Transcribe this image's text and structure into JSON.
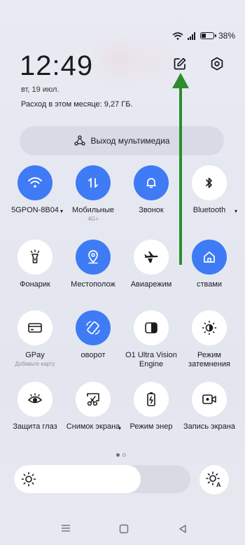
{
  "status": {
    "battery": "38%",
    "battery_level": 0.38,
    "signal_icon": "wifi-signal-icon"
  },
  "header": {
    "time": "12:49",
    "date": "вт, 19 июл.",
    "usage": "Расход в этом месяце: 9,27 ГБ."
  },
  "media": {
    "label": "Выход мультимедиа"
  },
  "tiles": [
    {
      "label": "5GPON-8B04",
      "sub": "",
      "icon": "wifi-icon",
      "state": "on"
    },
    {
      "label": "Мобильные",
      "sub": "4G+",
      "icon": "mobile-data-icon",
      "state": "on"
    },
    {
      "label": "Звонок",
      "sub": "",
      "icon": "bell-icon",
      "state": "on"
    },
    {
      "label": "Bluetooth",
      "sub": "",
      "icon": "bluetooth-icon",
      "state": "off"
    },
    {
      "label": "Фонарик",
      "sub": "",
      "icon": "flashlight-icon",
      "state": "off"
    },
    {
      "label": "Местополож",
      "sub": "",
      "icon": "location-icon",
      "state": "on"
    },
    {
      "label": "Авиарежим",
      "sub": "",
      "icon": "airplane-icon",
      "state": "off"
    },
    {
      "label": "ствами",
      "sub": "",
      "icon": "home-icon",
      "state": "on"
    },
    {
      "label": "GPay",
      "sub": "Добавьте карту",
      "icon": "card-icon",
      "state": "off"
    },
    {
      "label": "оворот",
      "sub": "",
      "icon": "rotate-icon",
      "state": "on"
    },
    {
      "label": "O1 Ultra Vision Engine",
      "sub": "",
      "icon": "vision-icon",
      "state": "off"
    },
    {
      "label": "Режим затемнения",
      "sub": "",
      "icon": "dark-mode-icon",
      "state": "off"
    },
    {
      "label": "Защита глаз",
      "sub": "",
      "icon": "eye-icon",
      "state": "off"
    },
    {
      "label": "Снимок экрана",
      "sub": "",
      "icon": "screenshot-icon",
      "state": "off"
    },
    {
      "label": "Режим энер",
      "sub": "",
      "icon": "battery-saver-icon",
      "state": "off"
    },
    {
      "label": "Запись экрана",
      "sub": "",
      "icon": "screen-record-icon",
      "state": "off"
    }
  ],
  "brightness": {
    "level": 0.72
  },
  "colors": {
    "accent": "#3f7bf5",
    "arrow": "#2e8b2e"
  }
}
